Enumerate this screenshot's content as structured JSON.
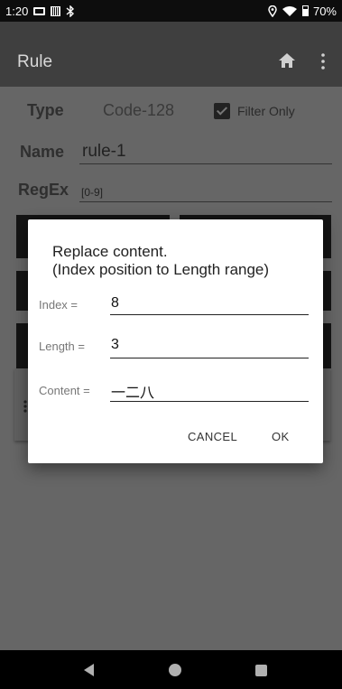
{
  "status_bar": {
    "time": "1:20",
    "battery": "70%"
  },
  "app_bar": {
    "title": "Rule"
  },
  "form": {
    "type_label": "Type",
    "type_value": "Code-128",
    "filter_only_label": "Filter Only",
    "filter_only_checked": true,
    "name_label": "Name",
    "name_value": "rule-1",
    "regex_label": "RegEx",
    "regex_value": "[0-9]"
  },
  "dialog": {
    "title": "Replace content.\n(Index position to Length range)",
    "index_label": "Index =",
    "index_value": "8",
    "length_label": "Length =",
    "length_value": "3",
    "content_label": "Content =",
    "content_value": "一二八",
    "cancel_label": "CANCEL",
    "ok_label": "OK"
  },
  "colors": {
    "overlay_bg": "#666666",
    "app_bar_bg": "#3f3f3f",
    "dialog_bg": "#ffffff"
  }
}
